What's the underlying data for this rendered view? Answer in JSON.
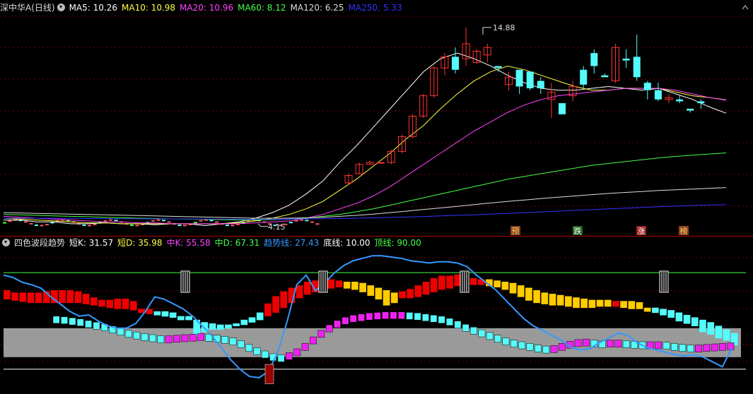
{
  "main_panel": {
    "title": "深中华A(日线)",
    "ma": [
      {
        "label": "MA5",
        "value": "10.26",
        "color": "#ffffff"
      },
      {
        "label": "MA10",
        "value": "10.98",
        "color": "#ffff44"
      },
      {
        "label": "MA20",
        "value": "10.96",
        "color": "#ff44ff"
      },
      {
        "label": "MA60",
        "value": "8.12",
        "color": "#44ff44"
      },
      {
        "label": "MA120",
        "value": "6.25",
        "color": "#dddddd"
      },
      {
        "label": "MA250",
        "value": "5.33",
        "color": "#3333ff"
      }
    ],
    "high_label": "14.88",
    "low_label": "4.15",
    "signals": [
      {
        "text": "预",
        "bg": "#884422",
        "color": "#ffcc66"
      },
      {
        "text": "跌",
        "bg": "#226622",
        "color": "#ffffff"
      },
      {
        "text": "涨",
        "bg": "#992222",
        "color": "#ffffff"
      },
      {
        "text": "榜",
        "bg": "#884422",
        "color": "#ffcc66"
      }
    ]
  },
  "indicator_panel": {
    "title": "四色波段趋势",
    "items": [
      {
        "label": "短K",
        "value": "31.57",
        "color": "#ffffff"
      },
      {
        "label": "短D",
        "value": "35.98",
        "color": "#ffff44"
      },
      {
        "label": "中K",
        "value": "55.58",
        "color": "#ff44ff"
      },
      {
        "label": "中D",
        "value": "67.31",
        "color": "#44ff44"
      },
      {
        "label": "趋势线",
        "value": "27.43",
        "color": "#3399ff"
      },
      {
        "label": "底线",
        "value": "10.00",
        "color": "#ffffff"
      },
      {
        "label": "顶线",
        "value": "90.00",
        "color": "#44ff44"
      }
    ]
  },
  "colors": {
    "up": "#ff3333",
    "down": "#54fcfc",
    "grid": "#7a0000"
  },
  "chart_data": [
    {
      "type": "candlestick",
      "title": "深中华A(日线)",
      "series": [
        {
          "name": "MA5",
          "values": [
            4.5,
            4.5,
            4.4,
            4.4,
            4.3,
            4.3,
            4.35,
            4.3,
            4.3,
            4.25,
            4.3,
            4.3,
            4.2,
            4.3,
            4.4,
            4.6,
            4.9,
            5.3,
            5.9,
            6.6,
            7.6,
            8.5,
            9.5,
            10.5,
            11.5,
            12.5,
            13.2,
            13.5,
            13.2,
            12.8,
            12.3,
            11.9,
            11.6,
            11.5,
            11.5,
            11.6,
            11.7,
            11.6,
            11.5,
            11.6,
            11.3,
            11.0,
            10.6,
            10.26
          ]
        },
        {
          "name": "MA10",
          "values": [
            4.6,
            4.55,
            4.5,
            4.45,
            4.4,
            4.35,
            4.35,
            4.3,
            4.3,
            4.3,
            4.3,
            4.3,
            4.3,
            4.3,
            4.35,
            4.45,
            4.6,
            4.8,
            5.1,
            5.5,
            6.1,
            6.7,
            7.4,
            8.1,
            8.9,
            9.6,
            10.5,
            11.3,
            12.0,
            12.5,
            12.8,
            12.6,
            12.3,
            12.0,
            11.7,
            11.5,
            11.5,
            11.6,
            11.6,
            11.6,
            11.4,
            11.2,
            11.1,
            10.98
          ]
        },
        {
          "name": "MA20",
          "values": [
            4.7,
            4.65,
            4.6,
            4.55,
            4.5,
            4.45,
            4.4,
            4.4,
            4.35,
            4.35,
            4.3,
            4.3,
            4.3,
            4.3,
            4.3,
            4.35,
            4.4,
            4.45,
            4.6,
            4.8,
            5.1,
            5.4,
            5.8,
            6.3,
            6.9,
            7.5,
            8.1,
            8.7,
            9.3,
            9.8,
            10.3,
            10.7,
            11.0,
            11.2,
            11.3,
            11.4,
            11.5,
            11.6,
            11.6,
            11.6,
            11.5,
            11.3,
            11.1,
            10.96
          ]
        },
        {
          "name": "MA60",
          "values": [
            4.8,
            4.78,
            4.75,
            4.72,
            4.7,
            4.68,
            4.65,
            4.63,
            4.6,
            4.58,
            4.56,
            4.55,
            4.53,
            4.52,
            4.5,
            4.5,
            4.52,
            4.55,
            4.6,
            4.7,
            4.8,
            4.95,
            5.1,
            5.3,
            5.5,
            5.7,
            5.9,
            6.1,
            6.3,
            6.5,
            6.7,
            6.85,
            7.0,
            7.15,
            7.3,
            7.45,
            7.55,
            7.65,
            7.75,
            7.85,
            7.93,
            8.0,
            8.06,
            8.12
          ]
        },
        {
          "name": "MA120",
          "values": [
            4.9,
            4.88,
            4.86,
            4.84,
            4.82,
            4.8,
            4.78,
            4.76,
            4.74,
            4.72,
            4.7,
            4.68,
            4.66,
            4.64,
            4.62,
            4.6,
            4.6,
            4.6,
            4.62,
            4.65,
            4.7,
            4.75,
            4.82,
            4.9,
            4.98,
            5.07,
            5.15,
            5.24,
            5.33,
            5.42,
            5.5,
            5.58,
            5.66,
            5.73,
            5.8,
            5.87,
            5.93,
            5.99,
            6.04,
            6.09,
            6.13,
            6.17,
            6.21,
            6.25
          ]
        },
        {
          "name": "MA250",
          "values": [
            4.6,
            4.6,
            4.6,
            4.59,
            4.59,
            4.58,
            4.58,
            4.57,
            4.57,
            4.56,
            4.56,
            4.55,
            4.55,
            4.55,
            4.54,
            4.54,
            4.54,
            4.55,
            4.56,
            4.57,
            4.58,
            4.6,
            4.62,
            4.64,
            4.66,
            4.69,
            4.72,
            4.75,
            4.78,
            4.82,
            4.86,
            4.9,
            4.94,
            4.98,
            5.02,
            5.06,
            5.1,
            5.14,
            5.18,
            5.22,
            5.25,
            5.28,
            5.31,
            5.33
          ]
        }
      ],
      "candles": [
        [
          6.5,
          7.0,
          6.4,
          6.9
        ],
        [
          7.0,
          7.6,
          7.0,
          7.5
        ],
        [
          7.5,
          7.7,
          7.5,
          7.6
        ],
        [
          7.6,
          7.6,
          7.6,
          7.6
        ],
        [
          7.6,
          8.3,
          7.5,
          8.2
        ],
        [
          8.2,
          9.1,
          8.1,
          9.0
        ],
        [
          9.0,
          10.2,
          8.9,
          10.1
        ],
        [
          10.1,
          11.3,
          10.0,
          11.2
        ],
        [
          11.2,
          12.8,
          11.1,
          12.7
        ],
        [
          12.7,
          13.5,
          12.3,
          13.3
        ],
        [
          13.3,
          13.8,
          12.4,
          12.6
        ],
        [
          13.2,
          14.88,
          12.8,
          14.0
        ],
        [
          13.0,
          13.7,
          12.9,
          13.6
        ],
        [
          13.4,
          14.0,
          13.0,
          13.8
        ],
        [
          12.8,
          12.8,
          12.5,
          12.7
        ],
        [
          11.8,
          12.5,
          11.5,
          12.2
        ],
        [
          12.6,
          12.6,
          11.3,
          11.7
        ],
        [
          12.5,
          12.5,
          11.5,
          11.6
        ],
        [
          12.0,
          12.2,
          11.3,
          11.6
        ],
        [
          11.0,
          11.9,
          10.0,
          11.4
        ],
        [
          10.8,
          10.8,
          10.2,
          10.2
        ],
        [
          11.2,
          12.0,
          10.9,
          11.7
        ],
        [
          12.6,
          12.8,
          11.6,
          11.8
        ],
        [
          13.5,
          13.7,
          12.4,
          12.8
        ],
        [
          12.3,
          12.4,
          12.2,
          12.2
        ],
        [
          12.0,
          14.0,
          11.9,
          13.8
        ],
        [
          13.2,
          13.7,
          12.7,
          13.1
        ],
        [
          13.3,
          14.5,
          12.0,
          12.2
        ],
        [
          11.9,
          12.0,
          11.0,
          11.5
        ],
        [
          11.5,
          11.9,
          10.9,
          11.0
        ],
        [
          11.0,
          11.3,
          10.8,
          11.1
        ],
        [
          11.0,
          11.2,
          10.8,
          10.9
        ],
        [
          10.5,
          10.5,
          10.3,
          10.4
        ],
        [
          10.9,
          11.0,
          10.5,
          10.8
        ]
      ],
      "high_marker": 14.88,
      "low_marker": 4.15,
      "ylim": [
        3.8,
        15.6
      ]
    },
    {
      "type": "bar",
      "title": "四色波段趋势",
      "series": [
        {
          "name": "短K",
          "values": [
            72,
            70,
            70,
            70,
            70,
            71,
            72,
            72,
            72,
            71,
            69,
            66,
            64,
            64,
            65,
            65,
            63,
            60,
            60,
            58,
            58,
            57,
            53,
            54,
            40,
            43,
            45,
            45,
            46,
            48,
            51,
            53,
            57,
            61,
            67,
            71,
            74,
            76,
            79,
            80,
            80,
            81,
            80,
            78,
            77,
            75,
            72,
            69,
            64,
            66,
            71,
            73,
            76,
            79,
            82,
            84,
            84,
            85,
            84,
            82,
            81,
            80,
            79,
            77,
            74,
            71,
            68,
            66,
            65,
            64,
            64,
            63,
            62,
            62,
            62,
            63,
            63,
            63,
            62,
            61,
            61,
            60,
            59,
            57,
            55,
            52,
            50,
            48,
            43,
            41,
            38,
            36,
            32
          ]
        },
        {
          "name": "短D",
          "values": [
            69,
            68,
            67,
            66,
            66,
            66,
            66,
            66,
            66,
            66,
            65,
            64,
            63,
            62,
            61,
            61,
            60,
            59,
            58,
            57,
            56,
            55,
            54,
            53,
            51,
            49,
            48,
            47,
            47,
            48,
            49,
            51,
            53,
            55,
            58,
            62,
            66,
            70,
            73,
            75,
            77,
            78,
            79,
            79,
            79,
            78,
            76,
            74,
            72,
            70,
            70,
            70,
            71,
            73,
            75,
            77,
            78,
            80,
            81,
            81,
            81,
            81,
            80,
            79,
            78,
            76,
            74,
            72,
            70,
            69,
            68,
            67,
            66,
            65,
            64,
            64,
            64,
            63,
            63,
            63,
            62,
            61,
            61,
            60,
            59,
            57,
            55,
            53,
            51,
            49,
            46,
            43,
            40,
            36
          ]
        },
        {
          "name": "中K",
          "values": [
            80,
            79,
            77,
            75,
            72,
            69,
            66,
            62,
            58,
            54,
            51,
            48,
            46,
            44,
            44,
            45,
            46,
            47,
            48,
            47,
            45,
            43,
            40,
            35,
            28,
            22,
            16,
            11,
            9,
            13,
            20,
            30,
            42,
            54,
            64,
            72,
            78,
            82,
            84,
            86,
            87,
            88,
            88,
            88,
            87,
            86,
            84,
            82,
            80,
            76,
            71,
            65,
            60,
            55,
            50,
            45,
            40,
            36,
            33,
            30,
            27,
            25,
            26,
            30,
            34,
            37,
            38,
            36,
            35,
            36,
            36,
            35,
            34,
            33,
            33,
            33,
            32,
            30,
            28,
            27,
            27,
            28,
            29,
            30,
            31
          ]
        },
        {
          "name": "中D",
          "values": [
            76,
            75,
            74,
            73,
            71,
            70,
            68,
            66,
            64,
            62,
            60,
            58,
            56,
            54,
            53,
            52,
            51,
            51,
            51,
            51,
            50,
            49,
            48,
            46,
            43,
            40,
            36,
            32,
            29,
            27,
            27,
            28,
            31,
            36,
            42,
            48,
            54,
            60,
            65,
            70,
            74,
            77,
            80,
            82,
            83,
            84,
            84,
            83,
            82,
            80,
            78,
            75,
            72,
            69,
            66,
            62,
            58,
            55,
            51,
            48,
            45,
            42,
            40,
            39,
            39,
            39,
            39,
            38,
            38,
            37,
            37,
            36,
            36,
            35,
            35,
            34,
            34,
            33,
            32,
            31,
            30,
            30,
            29,
            29,
            29
          ]
        },
        {
          "name": "趋势线",
          "values": [
            88,
            86,
            82,
            80,
            77,
            70,
            64,
            58,
            54,
            55,
            50,
            46,
            44,
            44,
            48,
            58,
            70,
            68,
            64,
            60,
            54,
            46,
            38,
            28,
            18,
            10,
            4,
            3,
            8,
            24,
            50,
            80,
            88,
            75,
            82,
            90,
            96,
            100,
            102,
            104,
            104,
            103,
            102,
            100,
            99,
            98,
            99,
            99,
            98,
            95,
            88,
            82,
            76,
            68,
            60,
            52,
            46,
            42,
            38,
            34,
            28,
            26,
            27,
            32,
            36,
            40,
            38,
            32,
            28,
            26,
            24,
            22,
            21,
            22,
            20,
            16,
            12,
            27.43
          ]
        },
        {
          "name": "底线",
          "values": [
            10
          ]
        },
        {
          "name": "顶线",
          "values": [
            90
          ]
        }
      ],
      "ylim": [
        0,
        110
      ],
      "grid": true
    }
  ]
}
